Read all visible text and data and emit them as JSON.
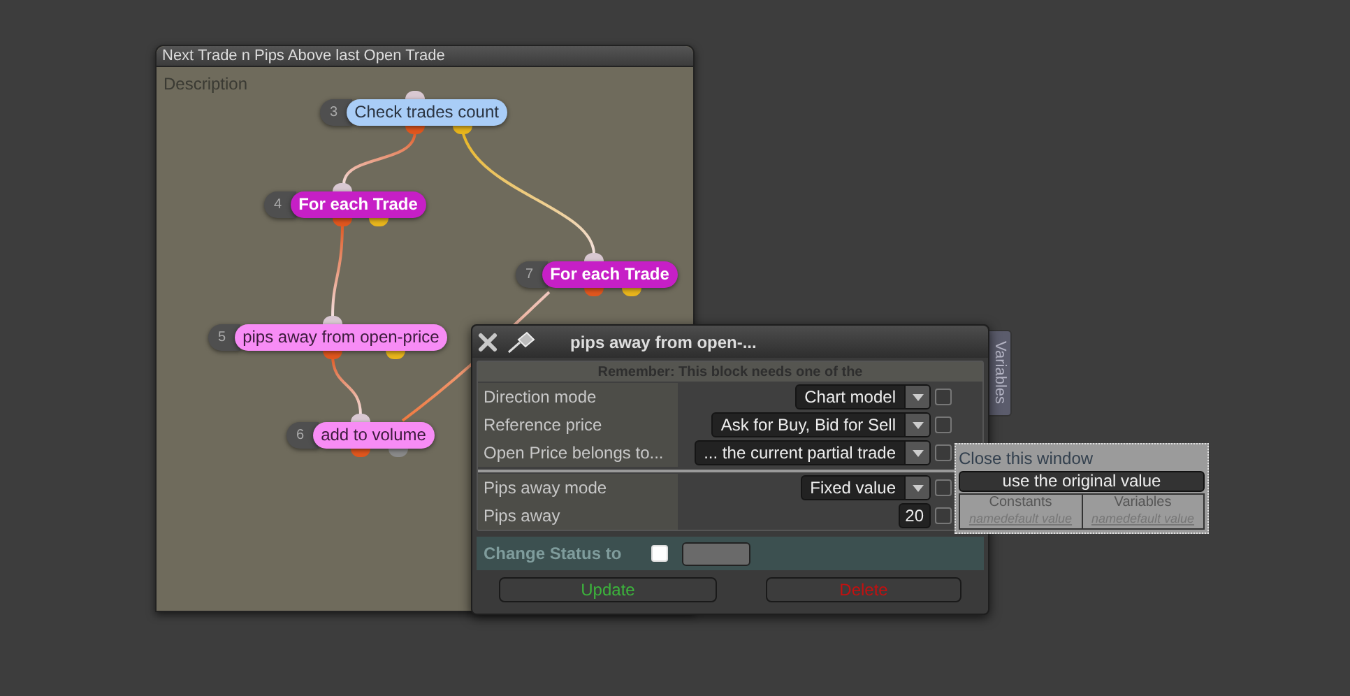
{
  "canvas": {
    "title": "Next Trade n Pips Above last Open Trade",
    "description_label": "Description",
    "nodes": [
      {
        "number": "3",
        "label": "Check trades count",
        "kind": "condition",
        "color": "#a9cdf7",
        "ports": [
          {
            "color": "#e0561e"
          },
          {
            "color": "#e8b51c"
          }
        ]
      },
      {
        "number": "4",
        "label": "For each Trade",
        "kind": "loop",
        "color": "#c61fc6",
        "ports": [
          {
            "color": "#e0561e"
          },
          {
            "color": "#e8b51c"
          }
        ]
      },
      {
        "number": "7",
        "label": "For each Trade",
        "kind": "loop",
        "color": "#c61fc6",
        "ports": [
          {
            "color": "#e0561e"
          },
          {
            "color": "#e8b51c"
          }
        ]
      },
      {
        "number": "5",
        "label": "pips away from open-price",
        "kind": "action",
        "color": "#f78cf5",
        "ports": [
          {
            "color": "#e0561e"
          },
          {
            "color": "#e8b51c"
          }
        ]
      },
      {
        "number": "6",
        "label": "add to volume",
        "kind": "action",
        "color": "#f78cf5",
        "ports": [
          {
            "color": "#e0561e"
          },
          {
            "color": "#8a8a8a"
          }
        ]
      }
    ]
  },
  "dialog": {
    "title": "pips away from open-...",
    "notice": "Remember: This block needs one of the",
    "sections": [
      [
        {
          "label": "Direction mode",
          "kind": "select",
          "value": "Chart model",
          "checked": false
        },
        {
          "label": "Reference price",
          "kind": "select",
          "value": "Ask for Buy, Bid for Sell",
          "checked": false
        },
        {
          "label": "Open Price belongs to...",
          "kind": "select",
          "value": "... the current partial trade",
          "checked": false
        }
      ],
      [
        {
          "label": "Pips away mode",
          "kind": "select",
          "value": "Fixed value",
          "checked": false
        },
        {
          "label": "Pips away",
          "kind": "number",
          "value": "20",
          "checked": false
        }
      ]
    ],
    "change_status": {
      "label": "Change Status to",
      "checked": false
    },
    "buttons": [
      {
        "label": "Update",
        "kind": "update"
      },
      {
        "label": "Delete",
        "kind": "delete"
      }
    ]
  },
  "side_tab": {
    "label": "Variables"
  },
  "popup": {
    "title": "Close this window",
    "button": "use the original value",
    "columns": [
      {
        "header": "Constants",
        "entry": "namedefault value"
      },
      {
        "header": "Variables",
        "entry": "namedefault value"
      }
    ]
  }
}
